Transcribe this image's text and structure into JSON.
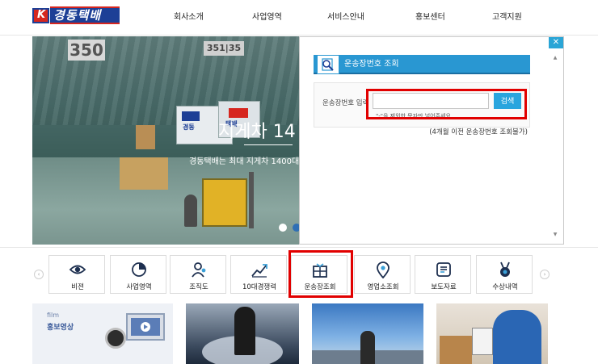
{
  "header": {
    "logo_text": "경동택배",
    "nav": [
      "회사소개",
      "사업영역",
      "서비스안내",
      "홍보센터",
      "고객지원"
    ]
  },
  "hero": {
    "sign_left": "350",
    "sign_right": "351|35",
    "truck_label": "경동",
    "truck2_label": "택배",
    "title": "지게차 14",
    "subtitle": "경동택배는 최대 지게차 1400대"
  },
  "tracking": {
    "title": "운송장번호 조회",
    "field_label": "운송장번호 입력",
    "input_value": "",
    "search_button": "검색",
    "hint": "\"-\"을 제외한 문자만 넣어주세요.",
    "note": "(4개월 이전 운송장번호 조회불가)",
    "close_symbol": "✕"
  },
  "quick_menu": {
    "items": [
      {
        "label": "비젼",
        "icon": "eye-icon"
      },
      {
        "label": "사업영역",
        "icon": "pie-chart-icon"
      },
      {
        "label": "조직도",
        "icon": "org-chart-icon"
      },
      {
        "label": "10대경쟁력",
        "icon": "growth-chart-icon"
      },
      {
        "label": "운송장조회",
        "icon": "parcel-box-icon"
      },
      {
        "label": "영업소조회",
        "icon": "map-pin-icon"
      },
      {
        "label": "보도자료",
        "icon": "document-icon"
      },
      {
        "label": "수상내역",
        "icon": "medal-icon"
      }
    ],
    "prev": "‹",
    "next": "›"
  },
  "tiles": {
    "film_en": "film",
    "film_ko": "홍보영상"
  },
  "colors": {
    "brand_blue": "#1d3f96",
    "brand_red": "#d6261f",
    "accent_sky": "#2997d2",
    "highlight_red": "#e10000"
  }
}
